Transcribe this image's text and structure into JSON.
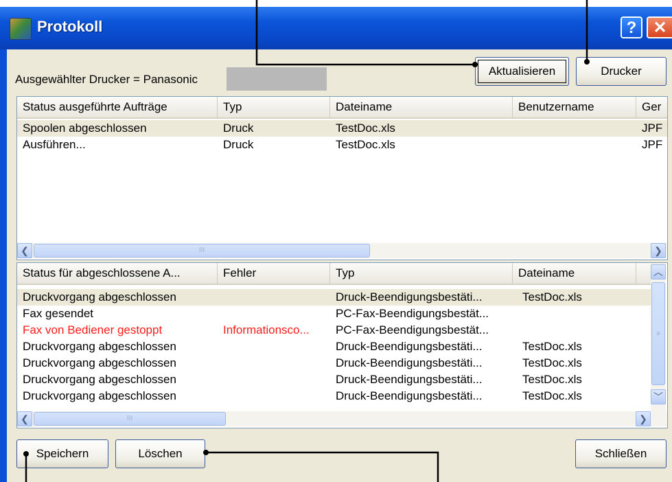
{
  "window": {
    "title": "Protokoll",
    "help_glyph": "?",
    "close_glyph": "✕"
  },
  "printer": {
    "label": "Ausgewählter Drucker = Panasonic"
  },
  "buttons": {
    "refresh": "Aktualisieren",
    "printer": "Drucker",
    "save": "Speichern",
    "delete": "Löschen",
    "close": "Schließen"
  },
  "running_jobs": {
    "columns": [
      "Status ausgeführte Aufträge",
      "Typ",
      "Dateiname",
      "Benutzername",
      "Ger"
    ],
    "rows": [
      [
        "Spoolen abgeschlossen",
        "Druck",
        "TestDoc.xls",
        "",
        "JPF"
      ],
      [
        "Ausführen...",
        "Druck",
        "TestDoc.xls",
        "",
        "JPF"
      ]
    ]
  },
  "completed_jobs": {
    "columns": [
      "Status für abgeschlossene A...",
      "Fehler",
      "Typ",
      "Dateiname"
    ],
    "rows": [
      [
        "Druckvorgang abgeschlossen",
        "",
        "Druck-Beendigungsbestäti...",
        "TestDoc.xls"
      ],
      [
        "Fax gesendet",
        "",
        "PC-Fax-Beendigungsbestät...",
        ""
      ],
      [
        "Fax von Bediener gestoppt",
        "Informationsco...",
        "PC-Fax-Beendigungsbestät...",
        ""
      ],
      [
        "Druckvorgang abgeschlossen",
        "",
        "Druck-Beendigungsbestäti...",
        "TestDoc.xls"
      ],
      [
        "Druckvorgang abgeschlossen",
        "",
        "Druck-Beendigungsbestäti...",
        "TestDoc.xls"
      ],
      [
        "Druckvorgang abgeschlossen",
        "",
        "Druck-Beendigungsbestäti...",
        "TestDoc.xls"
      ],
      [
        "Druckvorgang abgeschlossen",
        "",
        "Druck-Beendigungsbestäti...",
        "TestDoc.xls"
      ]
    ]
  },
  "scrollbar": {
    "grip": "III",
    "left": "❮",
    "right": "❯",
    "up": "︿",
    "down": "﹀"
  },
  "colors": {
    "error_row": "#ff1a1a",
    "titlebar": "#0846c6"
  }
}
